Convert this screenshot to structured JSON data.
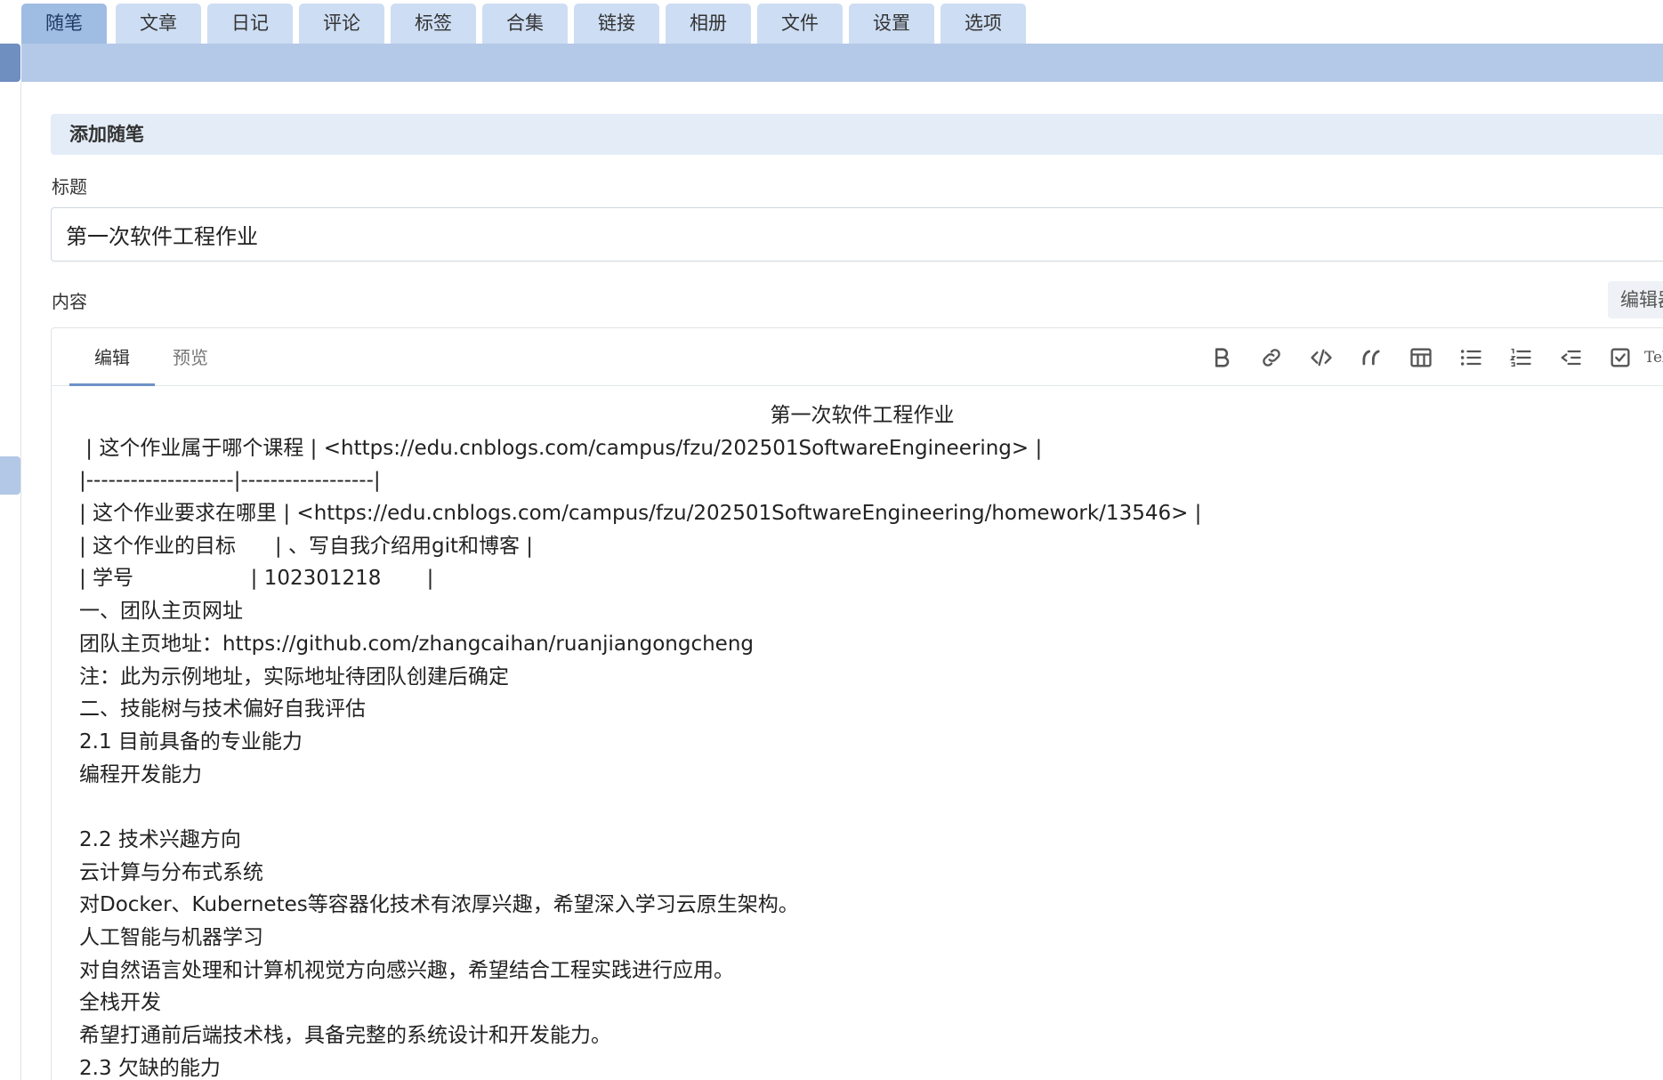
{
  "tabs": [
    {
      "label": "随笔",
      "active": true
    },
    {
      "label": "文章"
    },
    {
      "label": "日记"
    },
    {
      "label": "评论"
    },
    {
      "label": "标签"
    },
    {
      "label": "合集"
    },
    {
      "label": "链接"
    },
    {
      "label": "相册"
    },
    {
      "label": "文件"
    },
    {
      "label": "设置"
    },
    {
      "label": "选项"
    }
  ],
  "section_title": "添加随笔",
  "title_field": {
    "label": "标题",
    "value": "第一次软件工程作业"
  },
  "content_field": {
    "label": "内容",
    "editor_switch_label": "编辑器"
  },
  "editor": {
    "mode_tabs": [
      "编辑",
      "预览"
    ],
    "active_mode": "编辑",
    "toolbar_icons": [
      "bold-icon",
      "link-icon",
      "code-icon",
      "quote-icon",
      "table-icon",
      "bullet-list-icon",
      "ordered-list-icon",
      "outdent-icon",
      "checkbox-icon",
      "tex-icon"
    ],
    "tex_label": "TeX",
    "lines": [
      "第一次软件工程作业",
      " | 这个作业属于哪个课程 | <https://edu.cnblogs.com/campus/fzu/202501SoftwareEngineering> |",
      "|--------------------|------------------|",
      "| 这个作业要求在哪里 | <https://edu.cnblogs.com/campus/fzu/202501SoftwareEngineering/homework/13546> |",
      "| 这个作业的目标      | 、写自我介绍用git和博客 |",
      "| 学号                  | 102301218       |",
      "一、团队主页网址",
      "团队主页地址：https://github.com/zhangcaihan/ruanjiangongcheng",
      "注：此为示例地址，实际地址待团队创建后确定",
      "二、技能树与技术偏好自我评估",
      "2.1 目前具备的专业能力",
      "编程开发能力",
      "",
      "2.2 技术兴趣方向",
      "云计算与分布式系统",
      "对Docker、Kubernetes等容器化技术有浓厚兴趣，希望深入学习云原生架构。",
      "人工智能与机器学习",
      "对自然语言处理和计算机视觉方向感兴趣，希望结合工程实践进行应用。",
      "全栈开发",
      "希望打通前后端技术栈，具备完整的系统设计和开发能力。",
      "2.3 欠缺的能力"
    ]
  }
}
